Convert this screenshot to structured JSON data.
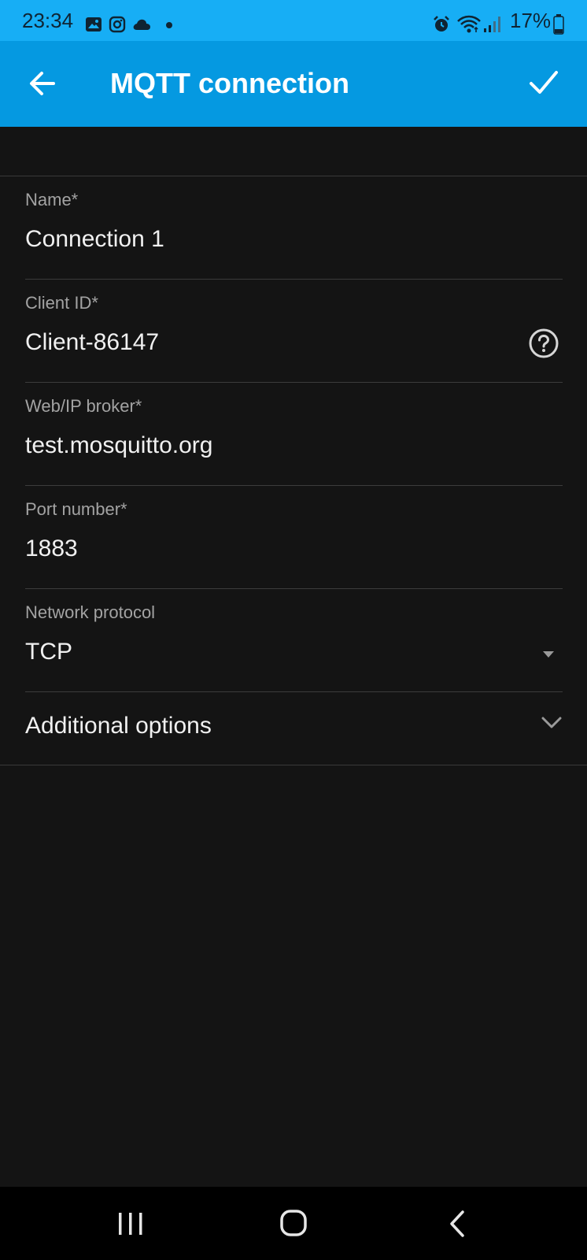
{
  "status_bar": {
    "time": "23:34",
    "battery": "17%",
    "icons": [
      "gallery-icon",
      "instagram-icon",
      "cloud-icon",
      "dot-icon",
      "alarm-icon",
      "wifi-icon",
      "signal-icon",
      "battery-icon"
    ]
  },
  "app_bar": {
    "title": "MQTT connection",
    "back_icon": "arrow-back-icon",
    "confirm_icon": "check-icon"
  },
  "form": {
    "name": {
      "label": "Name*",
      "value": "Connection 1"
    },
    "client_id": {
      "label": "Client ID*",
      "value": "Client-86147",
      "help_icon": "help-circle-icon"
    },
    "broker": {
      "label": "Web/IP broker*",
      "value": "test.mosquitto.org"
    },
    "port": {
      "label": "Port number*",
      "value": "1883"
    },
    "protocol": {
      "label": "Network protocol",
      "value": "TCP"
    },
    "additional_options": {
      "label": "Additional options"
    }
  },
  "nav_bar": {
    "buttons": [
      "recent-apps-icon",
      "home-icon",
      "back-icon"
    ]
  },
  "colors": {
    "status_bar_bg": "#17aef5",
    "app_bar_bg": "#0599e1",
    "background": "#141414",
    "label": "#a3a3a3",
    "value": "#f0f0f0"
  }
}
